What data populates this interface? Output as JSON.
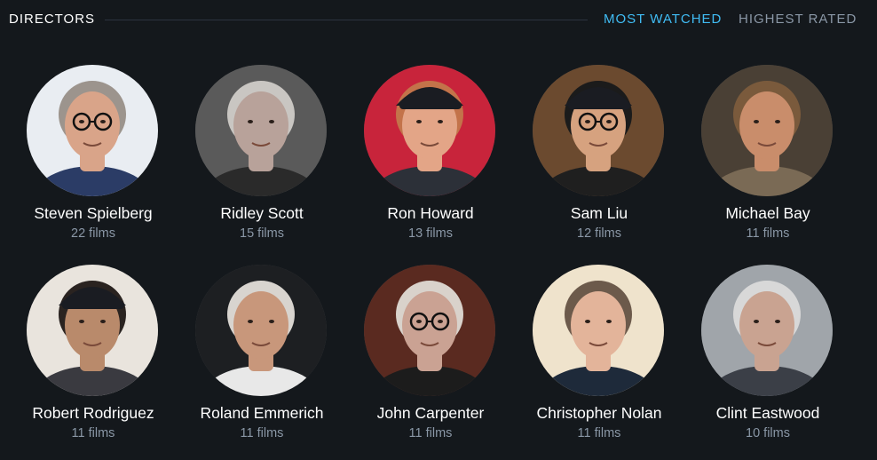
{
  "header": {
    "title": "DIRECTORS",
    "tabs": [
      {
        "label": "MOST WATCHED",
        "active": true
      },
      {
        "label": "HIGHEST RATED",
        "active": false
      }
    ]
  },
  "colors": {
    "background": "#14181c",
    "accent": "#40bcf4",
    "muted": "#8a97a6"
  },
  "directors": [
    {
      "name": "Steven Spielberg",
      "films": "22 films",
      "bg": "#e9edf2",
      "skin": "#d9a489",
      "hair": "#9c948d",
      "shirt": "#2b3c66",
      "cap": false,
      "glasses": true
    },
    {
      "name": "Ridley Scott",
      "films": "15 films",
      "bg": "#5a5a5a",
      "skin": "#b8a29a",
      "hair": "#c9c6c2",
      "shirt": "#2a2a2a",
      "cap": false,
      "glasses": false
    },
    {
      "name": "Ron Howard",
      "films": "13 films",
      "bg": "#c8243b",
      "skin": "#e3a587",
      "hair": "#c3734a",
      "shirt": "#2c3038",
      "cap": true,
      "glasses": false
    },
    {
      "name": "Sam Liu",
      "films": "12 films",
      "bg": "#6b4a2f",
      "skin": "#d6a27f",
      "hair": "#1b1b1b",
      "shirt": "#1f1f1f",
      "cap": true,
      "glasses": true
    },
    {
      "name": "Michael Bay",
      "films": "11 films",
      "bg": "#4a4035",
      "skin": "#c98d6b",
      "hair": "#7a5a3c",
      "shirt": "#7a6a55",
      "cap": false,
      "glasses": false
    },
    {
      "name": "Robert Rodriguez",
      "films": "11 films",
      "bg": "#e9e4dd",
      "skin": "#b98a6b",
      "hair": "#2a2320",
      "shirt": "#3a3a40",
      "cap": true,
      "glasses": false
    },
    {
      "name": "Roland Emmerich",
      "films": "11 films",
      "bg": "#1d1f22",
      "skin": "#c8977b",
      "hair": "#d8d4cf",
      "shirt": "#e8e8e8",
      "cap": false,
      "glasses": false
    },
    {
      "name": "John Carpenter",
      "films": "11 films",
      "bg": "#5a2a20",
      "skin": "#caa293",
      "hair": "#d9d2cb",
      "shirt": "#1c1c1c",
      "cap": false,
      "glasses": true
    },
    {
      "name": "Christopher Nolan",
      "films": "11 films",
      "bg": "#efe3cc",
      "skin": "#e3b49a",
      "hair": "#6c5a4b",
      "shirt": "#1e2a3a",
      "cap": false,
      "glasses": false
    },
    {
      "name": "Clint Eastwood",
      "films": "10 films",
      "bg": "#a0a5aa",
      "skin": "#c9a391",
      "hair": "#d8d8d8",
      "shirt": "#3b3f47",
      "cap": false,
      "glasses": false
    }
  ]
}
